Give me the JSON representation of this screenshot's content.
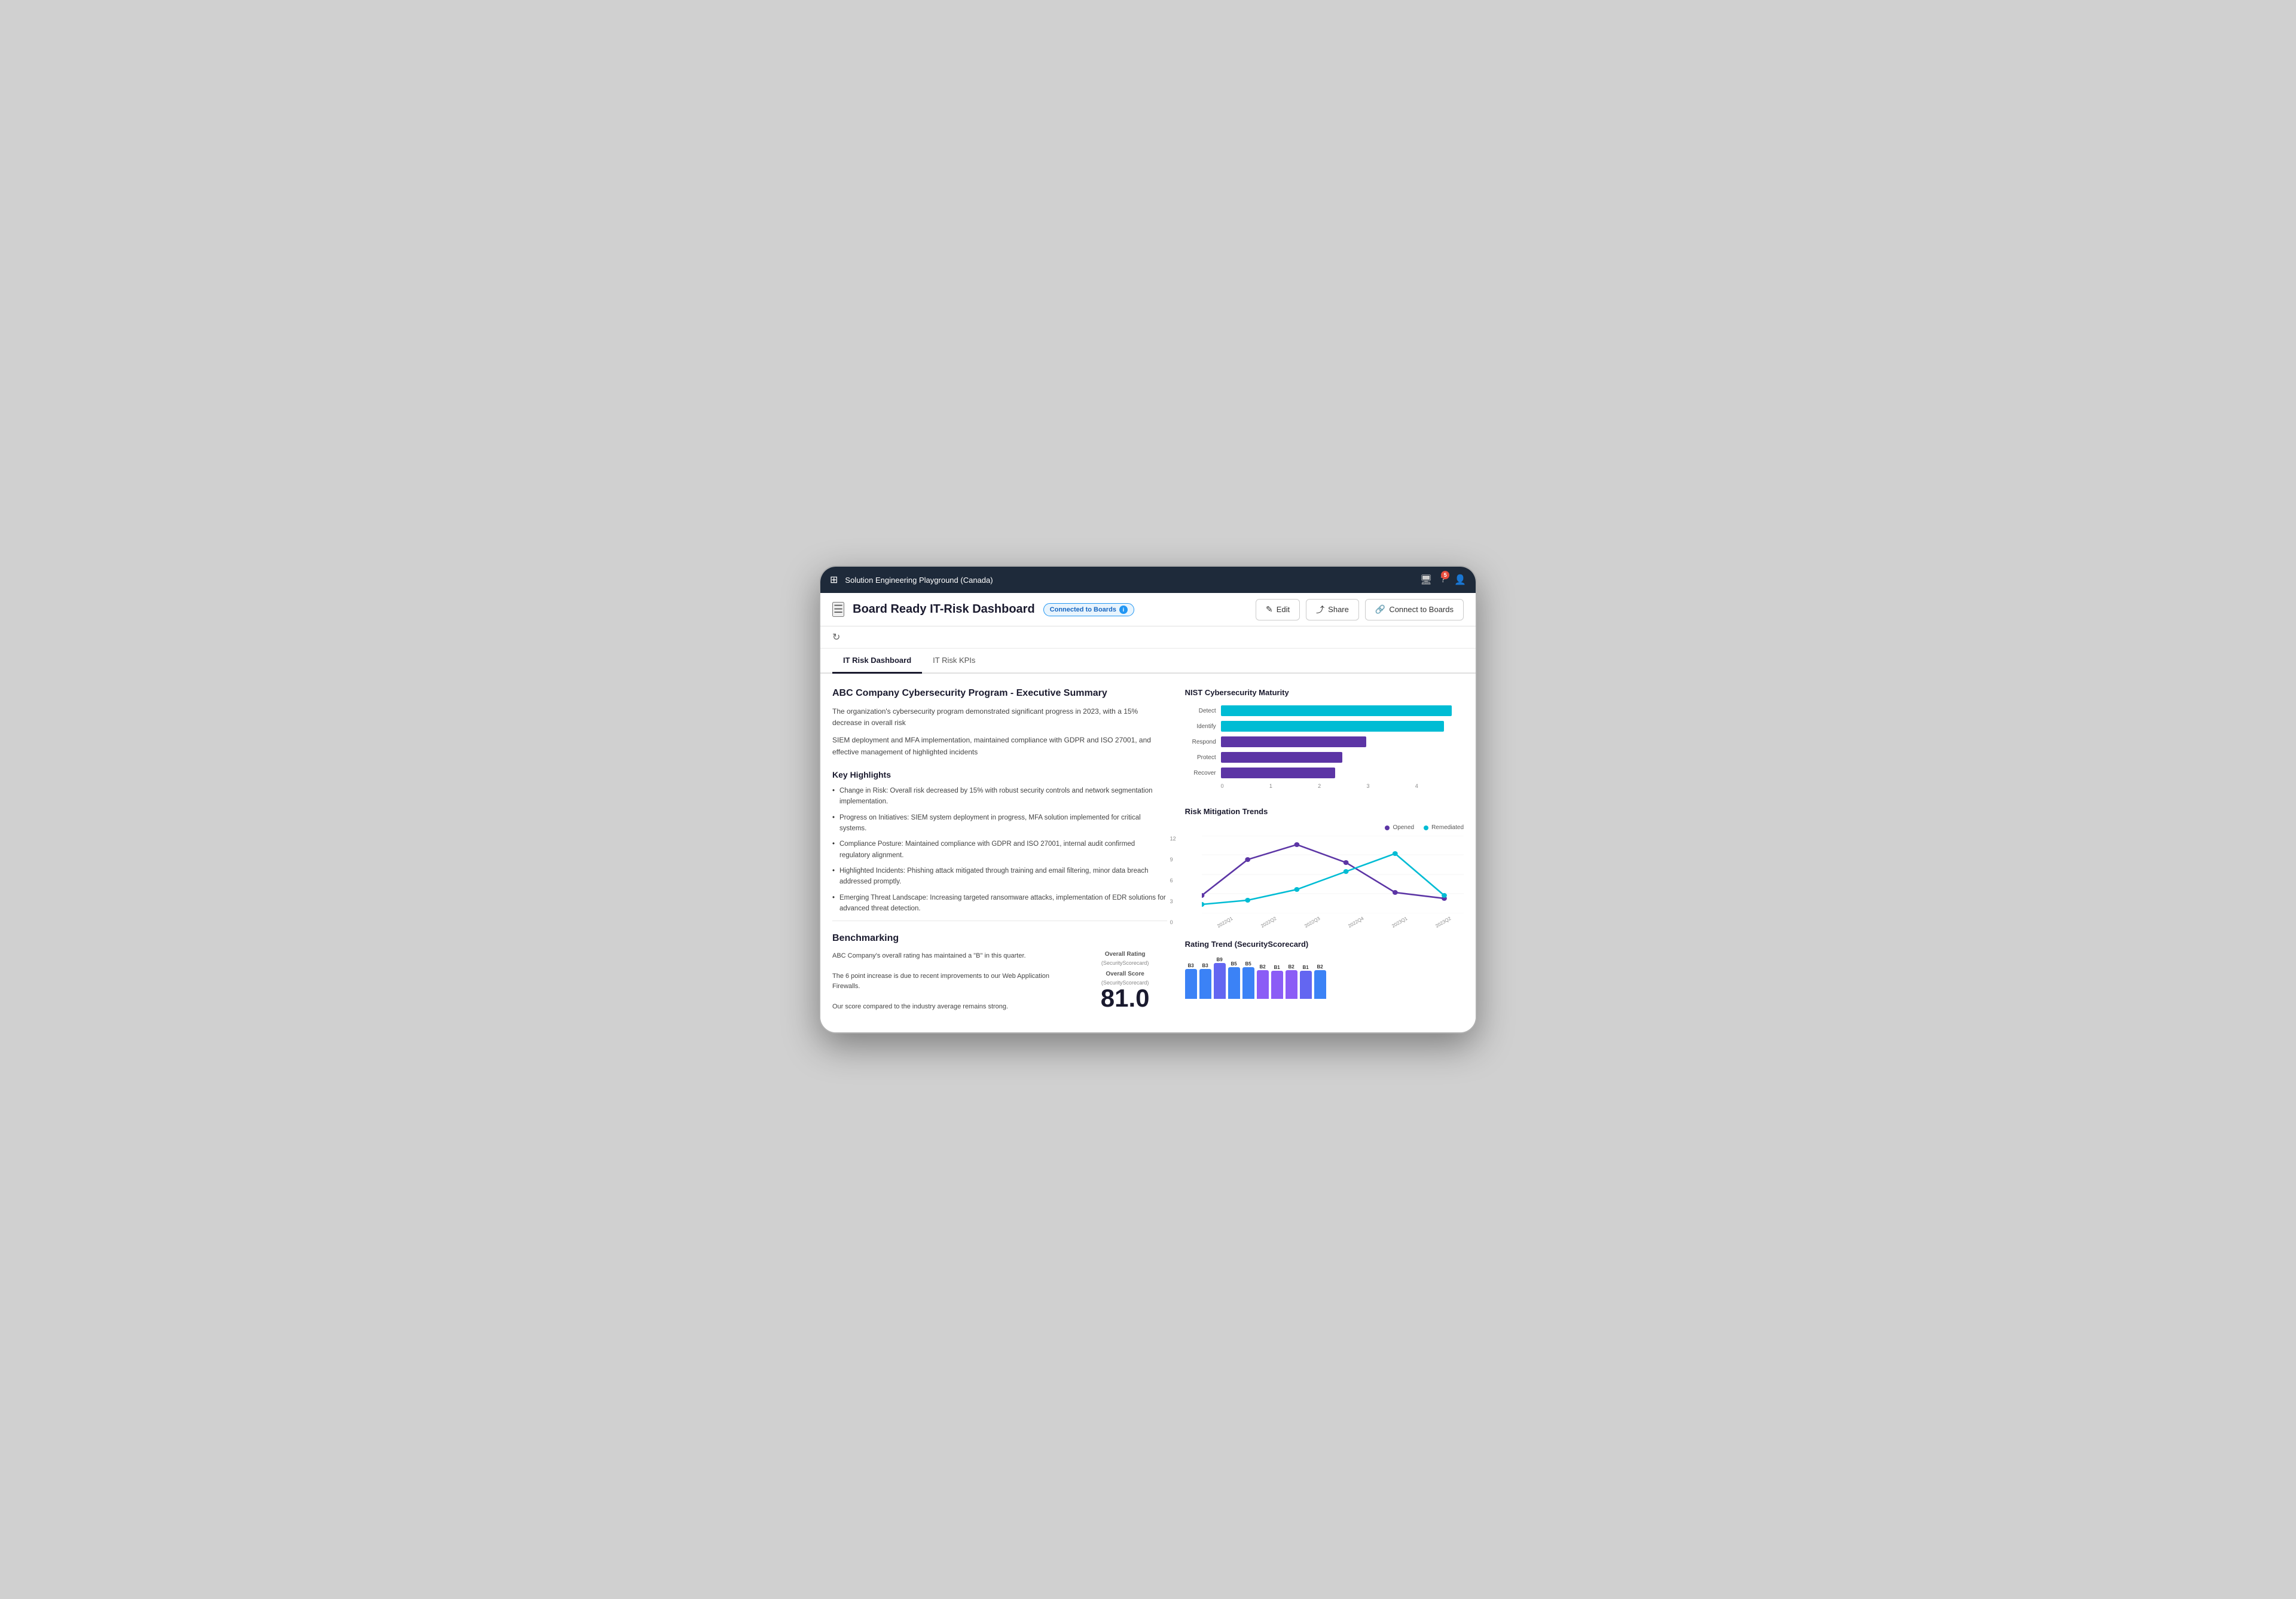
{
  "app": {
    "nav_title": "Solution Engineering Playground (Canada)",
    "badge_count": "5"
  },
  "header": {
    "page_title": "Board Ready IT-Risk Dashboard",
    "connected_label": "Connected to Boards",
    "edit_label": "Edit",
    "share_label": "Share",
    "connect_label": "Connect to Boards"
  },
  "tabs": [
    {
      "id": "it-risk-dashboard",
      "label": "IT Risk Dashboard",
      "active": true
    },
    {
      "id": "it-risk-kpis",
      "label": "IT Risk KPIs",
      "active": false
    }
  ],
  "executive_summary": {
    "title": "ABC Company Cybersecurity Program - Executive Summary",
    "paragraph1": "The organization's cybersecurity program demonstrated significant progress in 2023, with a 15% decrease in overall risk",
    "paragraph2": "SIEM deployment and MFA implementation, maintained compliance with GDPR and ISO 27001, and effective management of highlighted incidents",
    "key_highlights_title": "Key Highlights",
    "highlights": [
      "Change in Risk: Overall risk decreased by 15% with robust security controls and network segmentation implementation.",
      "Progress on Initiatives: SIEM system deployment in progress, MFA solution implemented for critical systems.",
      "Compliance Posture: Maintained compliance with GDPR and ISO 27001, internal audit confirmed regulatory alignment.",
      "Highlighted Incidents: Phishing attack mitigated through training and email filtering, minor data breach addressed promptly.",
      "Emerging Threat Landscape: Increasing targeted ransomware attacks, implementation of EDR solutions for advanced threat detection."
    ]
  },
  "nist_chart": {
    "title": "NIST Cybersecurity Maturity",
    "bars": [
      {
        "label": "Detect",
        "value": 3.8,
        "max": 4,
        "color": "cyan"
      },
      {
        "label": "Identify",
        "value": 3.7,
        "max": 4,
        "color": "cyan"
      },
      {
        "label": "Respond",
        "value": 2.4,
        "max": 4,
        "color": "purple"
      },
      {
        "label": "Protect",
        "value": 2.0,
        "max": 4,
        "color": "purple"
      },
      {
        "label": "Recover",
        "value": 1.9,
        "max": 4,
        "color": "purple"
      }
    ],
    "axis_labels": [
      "0",
      "1",
      "2",
      "3",
      "4"
    ]
  },
  "risk_mitigation": {
    "title": "Risk Mitigation Trends",
    "legend": {
      "opened": "Opened",
      "remediated": "Remediated"
    },
    "y_labels": [
      "12",
      "9",
      "6",
      "3",
      "0"
    ],
    "x_labels": [
      "2022Q1",
      "2022Q2",
      "2022Q3",
      "2022Q4",
      "2023Q1",
      "2023Q2"
    ]
  },
  "benchmarking": {
    "title": "Benchmarking",
    "description1": "ABC Company's overall rating has maintained a \"B\" in this quarter.",
    "description2": "The 6 point increase is due to recent improvements to our Web Application Firewalls.",
    "description3": "Our score compared to the industry average remains strong.",
    "overall_rating_label": "Overall Rating",
    "overall_rating_sub": "(SecurityScorecard)",
    "overall_score_label": "Overall Score",
    "overall_score_sub": "(SecurityScorecard)",
    "score_value": "81.0",
    "rating_trend_title": "Rating Trend (SecurityScorecard)",
    "trend_bars": [
      {
        "label": "B3",
        "height": 55,
        "color": "blue"
      },
      {
        "label": "B3",
        "height": 55,
        "color": "blue"
      },
      {
        "label": "B9",
        "height": 65,
        "color": "indigo"
      },
      {
        "label": "B5",
        "height": 58,
        "color": "blue"
      },
      {
        "label": "B5",
        "height": 58,
        "color": "blue"
      },
      {
        "label": "B2",
        "height": 54,
        "color": "purple"
      },
      {
        "label": "B1",
        "height": 53,
        "color": "purple"
      },
      {
        "label": "B2",
        "height": 54,
        "color": "purple"
      },
      {
        "label": "B1",
        "height": 53,
        "color": "indigo"
      },
      {
        "label": "B2",
        "height": 54,
        "color": "blue"
      }
    ]
  }
}
